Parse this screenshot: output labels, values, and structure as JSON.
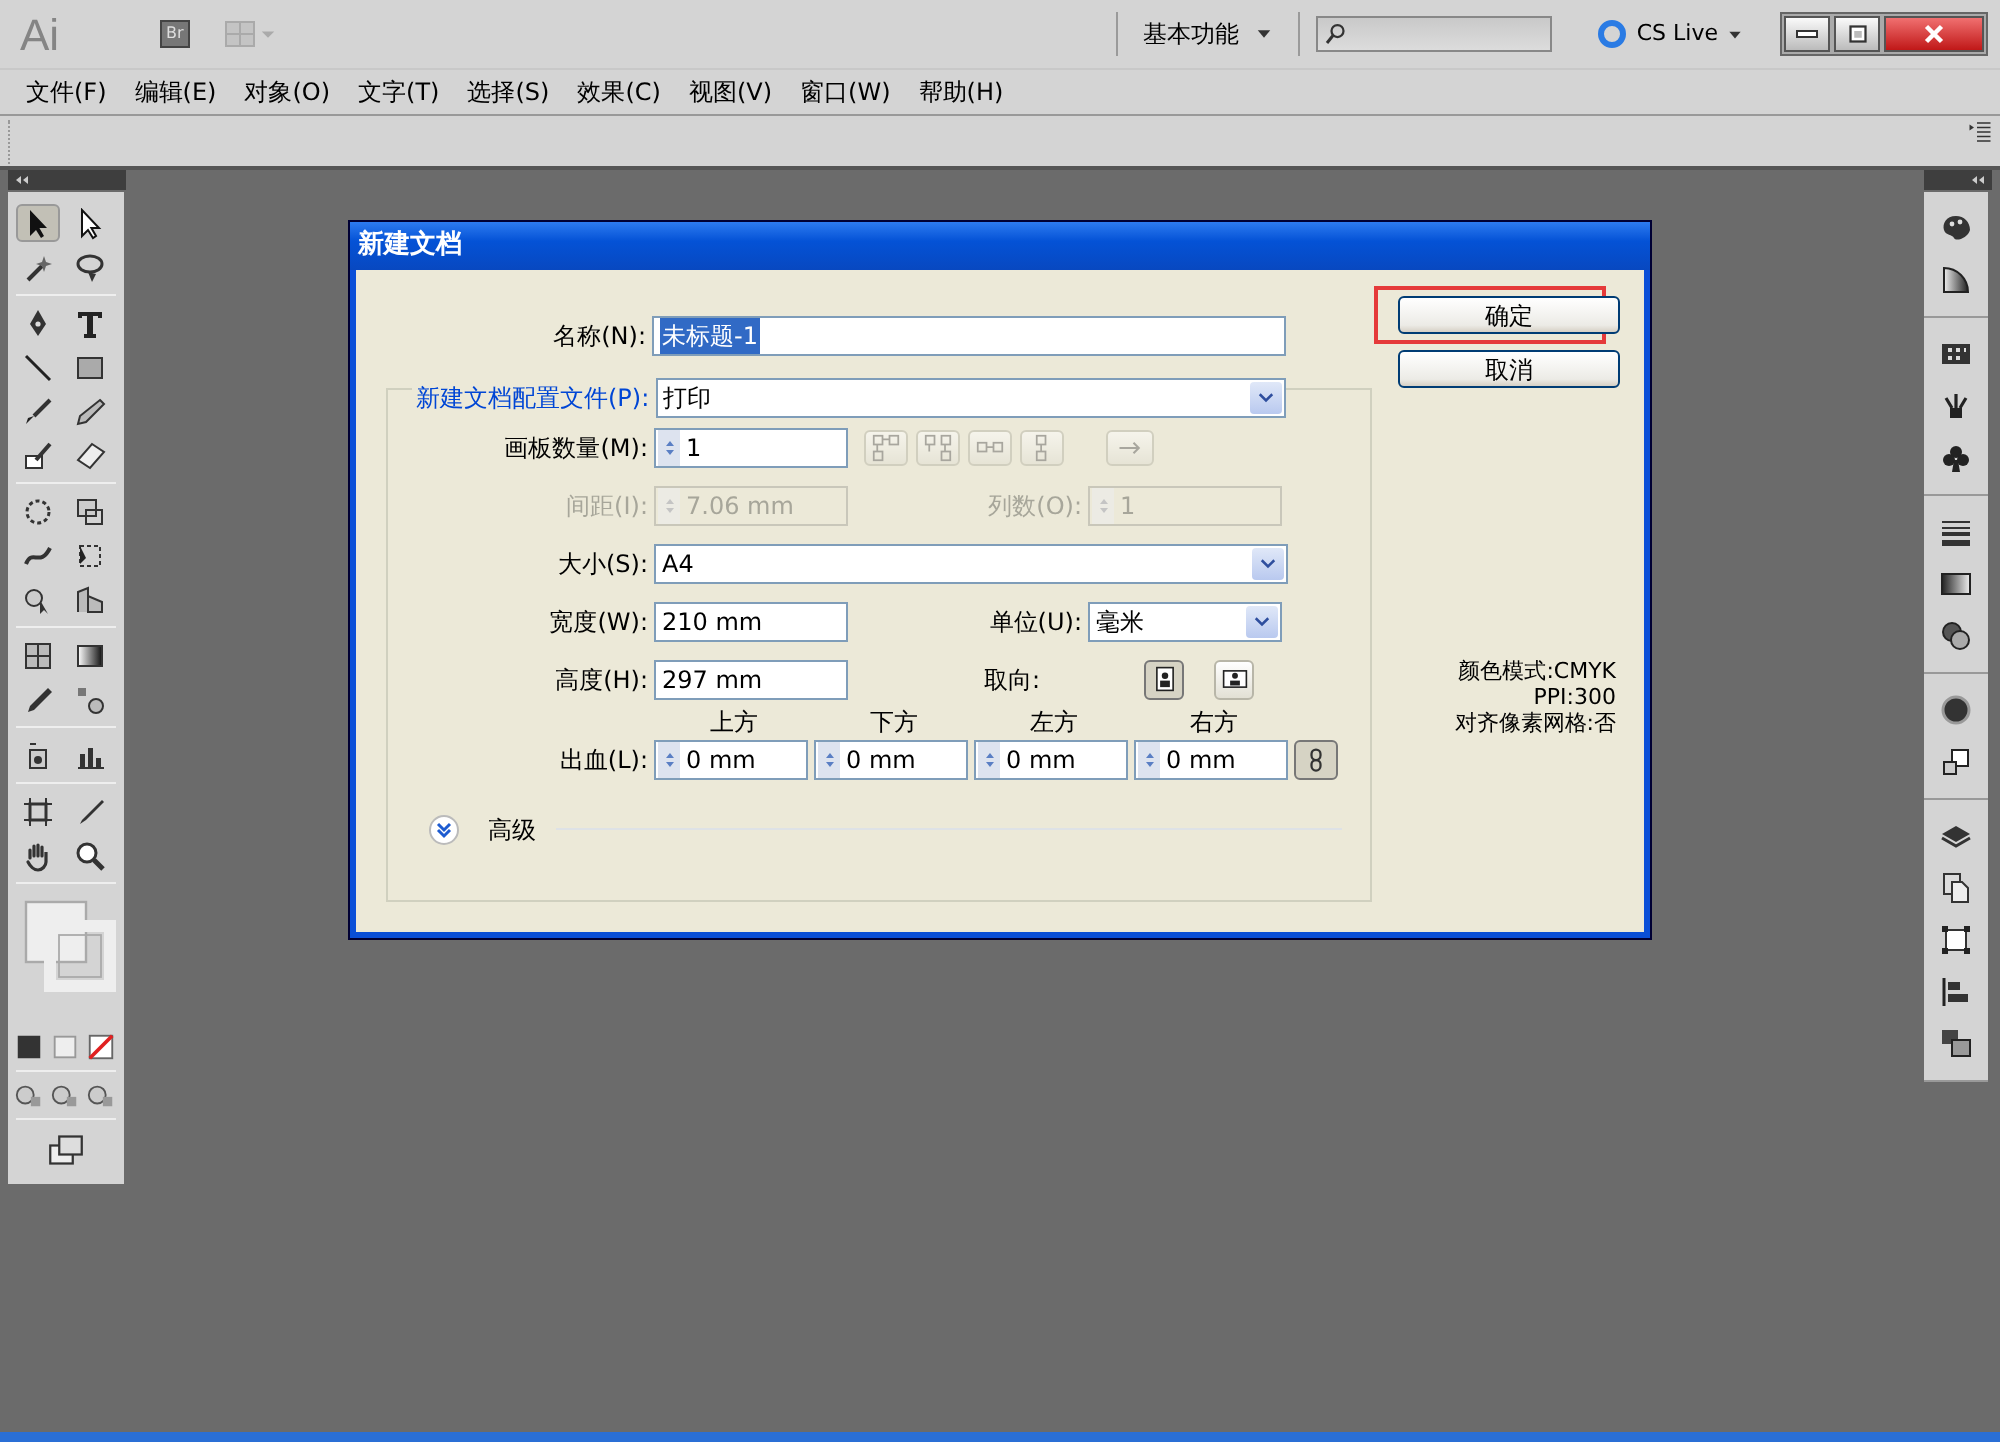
{
  "app": {
    "logo": "Ai",
    "bridge": "Br",
    "workspace": "基本功能",
    "cs_live": "CS Live"
  },
  "menu": [
    "文件(F)",
    "编辑(E)",
    "对象(O)",
    "文字(T)",
    "选择(S)",
    "效果(C)",
    "视图(V)",
    "窗口(W)",
    "帮助(H)"
  ],
  "dialog": {
    "title": "新建文档",
    "name": {
      "label": "名称(N):",
      "value": "未标题-1",
      "text_selected": true
    },
    "profile": {
      "label": "新建文档配置文件(P):",
      "value": "打印"
    },
    "artboards": {
      "label": "画板数量(M):",
      "value": "1",
      "layout_disabled": true
    },
    "spacing": {
      "label": "间距(I):",
      "value": "7.06 mm",
      "disabled": true
    },
    "columns": {
      "label": "列数(O):",
      "value": "1",
      "disabled": true
    },
    "size": {
      "label": "大小(S):",
      "value": "A4"
    },
    "width": {
      "label": "宽度(W):",
      "value": "210 mm"
    },
    "units": {
      "label": "单位(U):",
      "value": "毫米"
    },
    "height": {
      "label": "高度(H):",
      "value": "297 mm"
    },
    "orientation": {
      "label": "取向:",
      "options": [
        {
          "selected": true
        },
        {
          "selected": false
        }
      ]
    },
    "bleed": {
      "label": "出血(L):",
      "linked": true,
      "sides": [
        {
          "heading": "上方",
          "value": "0 mm"
        },
        {
          "heading": "下方",
          "value": "0 mm"
        },
        {
          "heading": "左方",
          "value": "0 mm"
        },
        {
          "heading": "右方",
          "value": "0 mm"
        }
      ]
    },
    "advanced": {
      "label": "高级",
      "expanded": false
    },
    "buttons": [
      {
        "label": "确定",
        "highlighted": true
      },
      {
        "label": "取消",
        "highlighted": false
      }
    ],
    "info": [
      "颜色模式:CMYK",
      "PPI:300",
      "对齐像素网格:否"
    ]
  }
}
